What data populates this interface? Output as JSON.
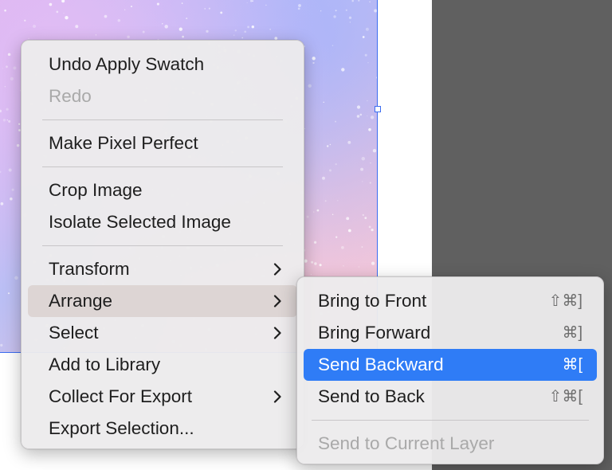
{
  "main_menu": {
    "items": [
      {
        "label": "Undo Apply Swatch"
      },
      {
        "label": "Redo"
      },
      {
        "label": "Make Pixel Perfect"
      },
      {
        "label": "Crop Image"
      },
      {
        "label": "Isolate Selected Image"
      },
      {
        "label": "Transform"
      },
      {
        "label": "Arrange"
      },
      {
        "label": "Select"
      },
      {
        "label": "Add to Library"
      },
      {
        "label": "Collect For Export"
      },
      {
        "label": "Export Selection..."
      }
    ]
  },
  "arrange_submenu": {
    "items": [
      {
        "label": "Bring to Front",
        "shortcut": "⇧⌘]"
      },
      {
        "label": "Bring Forward",
        "shortcut": "⌘]"
      },
      {
        "label": "Send Backward",
        "shortcut": "⌘["
      },
      {
        "label": "Send to Back",
        "shortcut": "⇧⌘["
      },
      {
        "label": "Send to Current Layer"
      }
    ]
  },
  "colors": {
    "highlight": "#2f7cf6",
    "hover": "#ddd5d4",
    "selection": "#3b6cf0",
    "pasteboard": "#606060"
  },
  "icons": {
    "submenu_arrow": "chevron-right-icon"
  }
}
